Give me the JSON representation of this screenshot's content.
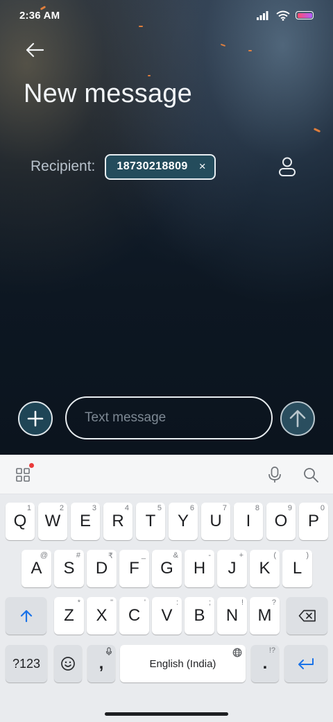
{
  "status_bar": {
    "time": "2:36 AM",
    "battery_color_start": "#ff4d6d",
    "battery_color_end": "#b35cff"
  },
  "header": {
    "back_icon": "arrow-left-icon",
    "title": "New message"
  },
  "recipient": {
    "label": "Recipient:",
    "chip_value": "18730218809",
    "chip_remove": "×",
    "contact_icon": "person-icon"
  },
  "composer": {
    "add_icon": "plus-icon",
    "placeholder": "Text message",
    "value": "",
    "send_icon": "arrow-up-icon"
  },
  "keyboard_toolbar": {
    "apps_icon": "grid-icon",
    "mic_icon": "microphone-icon",
    "search_icon": "search-icon"
  },
  "keyboard": {
    "row1": [
      {
        "key": "Q",
        "sub": "1"
      },
      {
        "key": "W",
        "sub": "2"
      },
      {
        "key": "E",
        "sub": "3"
      },
      {
        "key": "R",
        "sub": "4"
      },
      {
        "key": "T",
        "sub": "5"
      },
      {
        "key": "Y",
        "sub": "6"
      },
      {
        "key": "U",
        "sub": "7"
      },
      {
        "key": "I",
        "sub": "8"
      },
      {
        "key": "O",
        "sub": "9"
      },
      {
        "key": "P",
        "sub": "0"
      }
    ],
    "row2": [
      {
        "key": "A",
        "sub": "@"
      },
      {
        "key": "S",
        "sub": "#"
      },
      {
        "key": "D",
        "sub": "₹"
      },
      {
        "key": "F",
        "sub": "_"
      },
      {
        "key": "G",
        "sub": "&"
      },
      {
        "key": "H",
        "sub": "-"
      },
      {
        "key": "J",
        "sub": "+"
      },
      {
        "key": "K",
        "sub": "("
      },
      {
        "key": "L",
        "sub": ")"
      }
    ],
    "row3": [
      {
        "key": "Z",
        "sub": "*"
      },
      {
        "key": "X",
        "sub": "\""
      },
      {
        "key": "C",
        "sub": "'"
      },
      {
        "key": "V",
        "sub": ":"
      },
      {
        "key": "B",
        "sub": ";"
      },
      {
        "key": "N",
        "sub": "!"
      },
      {
        "key": "M",
        "sub": "?"
      }
    ],
    "shift_icon": "shift-arrow-icon",
    "backspace_icon": "backspace-icon",
    "symbols": "?123",
    "emoji_icon": "emoji-icon",
    "comma": ",",
    "space": "English (India)",
    "globe_icon": "globe-icon",
    "period": ".",
    "period_sub": "!?",
    "enter_icon": "enter-icon",
    "accent": "#1a73e8"
  }
}
